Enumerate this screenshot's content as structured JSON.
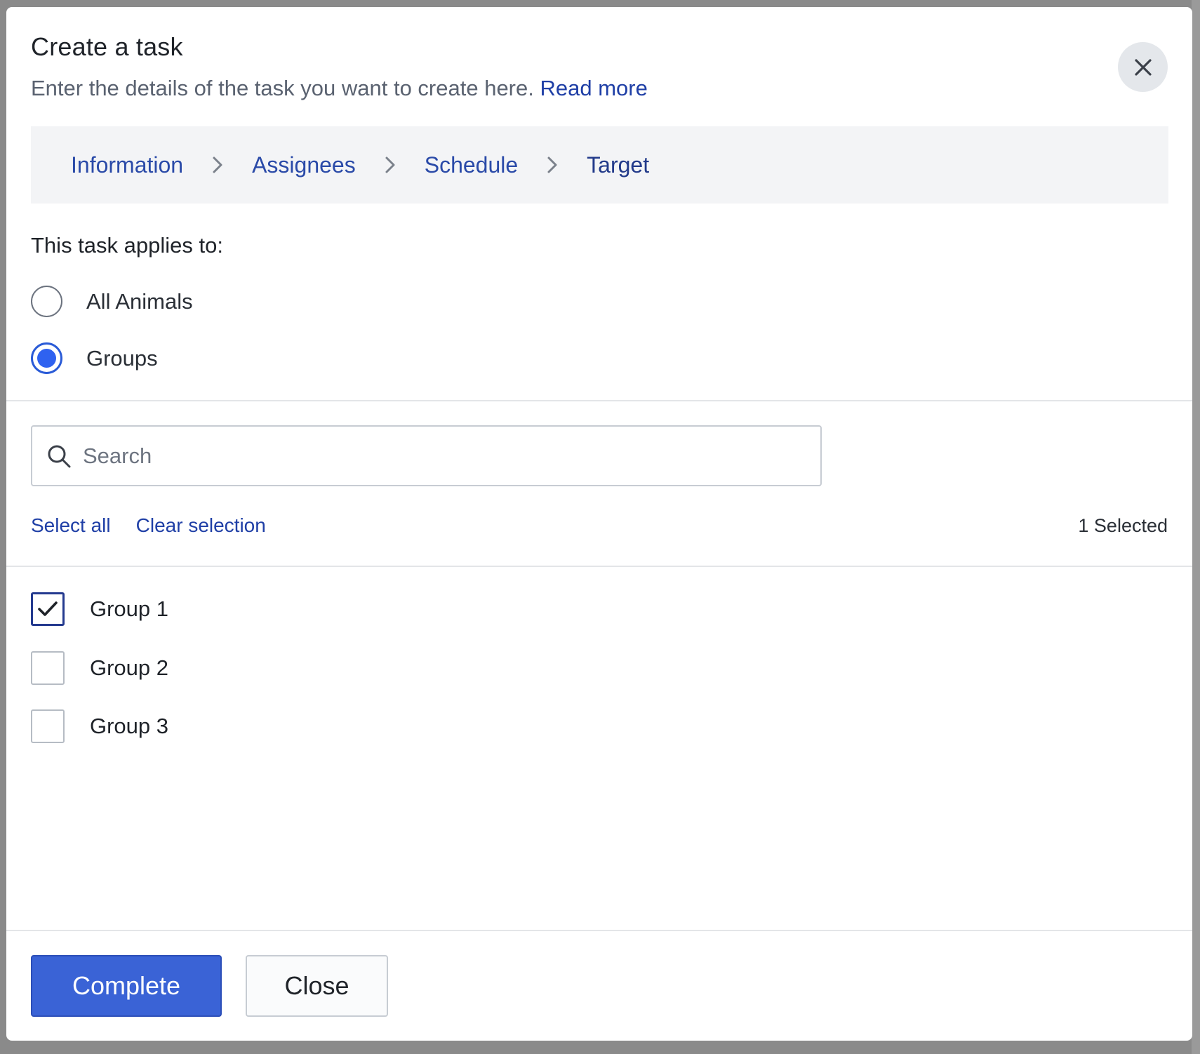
{
  "modal": {
    "title": "Create a task",
    "subtitle": "Enter the details of the task you want to create here.",
    "read_more": "Read more",
    "close_icon": "close-icon"
  },
  "steps": [
    {
      "label": "Information",
      "active": false
    },
    {
      "label": "Assignees",
      "active": false
    },
    {
      "label": "Schedule",
      "active": false
    },
    {
      "label": "Target",
      "active": true
    }
  ],
  "applies": {
    "label": "This task applies to:",
    "options": [
      {
        "label": "All Animals",
        "checked": false
      },
      {
        "label": "Groups",
        "checked": true
      }
    ]
  },
  "search": {
    "placeholder": "Search",
    "value": ""
  },
  "selection": {
    "select_all": "Select all",
    "clear": "Clear selection",
    "count_text": "1 Selected"
  },
  "groups": [
    {
      "label": "Group 1",
      "checked": true
    },
    {
      "label": "Group 2",
      "checked": false
    },
    {
      "label": "Group 3",
      "checked": false
    }
  ],
  "footer": {
    "complete": "Complete",
    "close": "Close"
  },
  "colors": {
    "accent": "#3a63d6",
    "link": "#1f3fa6",
    "radio": "#2f62f0"
  }
}
